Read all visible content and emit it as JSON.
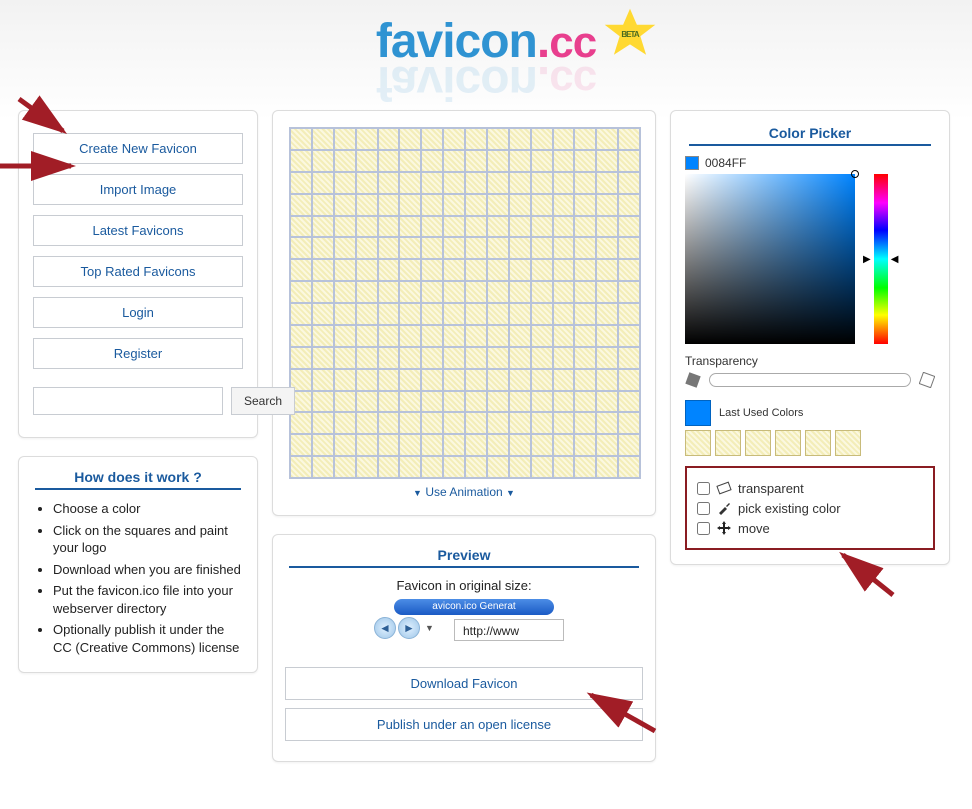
{
  "brand": {
    "name_part1": "favicon",
    "dot": ".",
    "name_part2": "cc",
    "badge": "BETA"
  },
  "nav": {
    "create": "Create New Favicon",
    "import": "Import Image",
    "latest": "Latest Favicons",
    "toprated": "Top Rated Favicons",
    "login": "Login",
    "register": "Register",
    "search_button": "Search",
    "search_value": ""
  },
  "editor": {
    "use_animation": "Use Animation"
  },
  "how": {
    "title": "How does it work ?",
    "items": [
      "Choose a color",
      "Click on the squares and paint your logo",
      "Download when you are finished",
      "Put the favicon.ico file into your webserver directory",
      "Optionally publish it under the CC (Creative Commons) license"
    ]
  },
  "preview": {
    "title": "Preview",
    "subtitle": "Favicon in original size:",
    "mock_tab_text": "avicon.ico Generat",
    "mock_url": "http://www",
    "download": "Download Favicon",
    "publish": "Publish under an open license"
  },
  "picker": {
    "title": "Color Picker",
    "current_hex": "0084FF",
    "hue_percent": 59,
    "transparency_label": "Transparency",
    "last_used_label": "Last Used Colors",
    "tools": {
      "transparent": "transparent",
      "pick": "pick existing color",
      "move": "move"
    }
  }
}
